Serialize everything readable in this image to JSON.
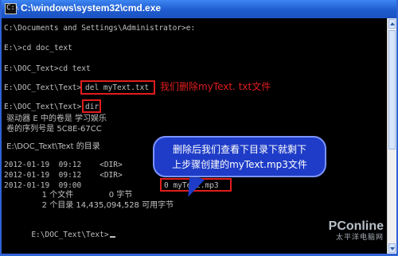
{
  "window": {
    "title": "C:\\windows\\system32\\cmd.exe",
    "icon": "cmd-icon"
  },
  "console": {
    "lines": [
      "C:\\Documents and Settings\\Administrator>e:",
      "E:\\>cd doc_text",
      "E:\\DOC_Text>cd text",
      "E:\\DOC_Text\\Text>",
      "del myText.txt",
      "E:\\DOC_Text\\Text>",
      "dir",
      " 驱动器 E 中的卷是 学习娱乐",
      " 卷的序列号是 5C8E-67CC",
      " E:\\DOC_Text\\Text 的目录",
      "2012-01-19  09:12    <DIR>          .",
      "2012-01-19  09:12    <DIR>          ..",
      "2012-01-19  09:00",
      "0 myText.mp3",
      "               1 个文件              0 字节",
      "               2 个目录 14,435,094,528 可用字节",
      "E:\\DOC_Text\\Text>"
    ]
  },
  "annotations": {
    "delete_note": "我们删除myText. txt文件",
    "callout_line1": "删除后我们查看下目录下就剩下",
    "callout_line2": "上步骤创建的myText.mp3文件"
  },
  "watermark": {
    "main": "PConline",
    "sub": "太平洋电脑网"
  },
  "colors": {
    "titlebar": "#1f5ccf",
    "console_bg": "#000000",
    "console_text": "#c0c0c0",
    "annotation_red": "#e11d1d",
    "callout_blue": "#1e3cc7"
  }
}
